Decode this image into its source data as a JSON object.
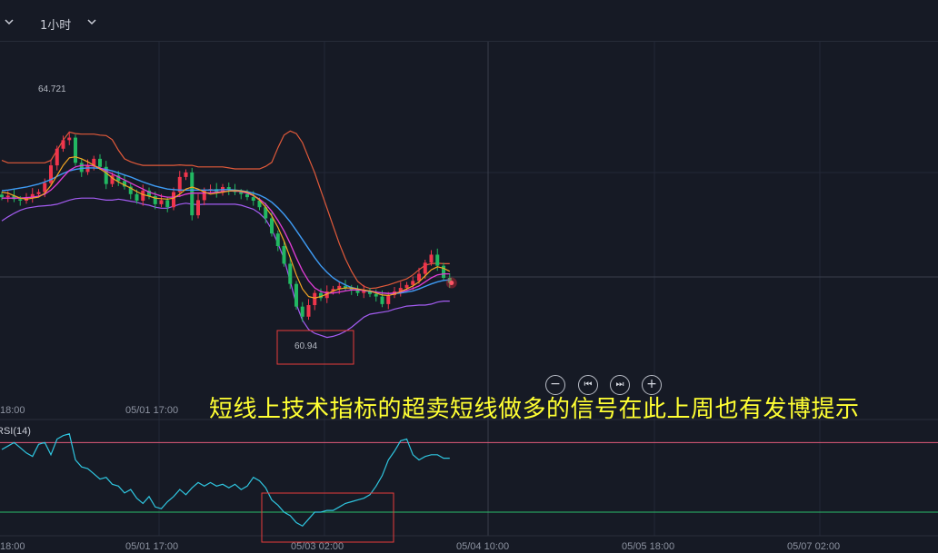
{
  "toolbar": {
    "interval": "1小时"
  },
  "zoom_controls": {
    "zoom_out": "−",
    "prev": "⏮",
    "next": "⏭",
    "zoom_in": "+"
  },
  "annotation": {
    "text": "短线上技术指标的超卖短线做多的信号在此上周也有发博提示"
  },
  "colors": {
    "background": "#161a25",
    "up_candle": "#f0354c",
    "down_candle": "#22b862",
    "boll_outer": "#e25a3a",
    "boll_lower": "#a45cf2",
    "ma_short": "#f5a623",
    "ma_mid": "#e23dd8",
    "ma_long": "#3e9bf4",
    "rsi_line": "#2fc6e0",
    "rsi_upper_level": "#e25a7a",
    "rsi_lower_level": "#2bbd6a",
    "highlight_box": "#e83c3c"
  },
  "chart_data": {
    "type": "candlestick",
    "main": {
      "high_label": "64.721",
      "low_label": "60.94",
      "x_ticks": [
        "18:00",
        "05/01 17:00"
      ],
      "price_range": [
        60.2,
        65.6
      ],
      "closes": [
        63.42,
        63.45,
        63.38,
        63.35,
        63.41,
        63.48,
        63.52,
        63.7,
        64.05,
        64.38,
        64.55,
        64.6,
        64.1,
        63.92,
        64.05,
        64.18,
        64.02,
        63.68,
        63.85,
        63.74,
        63.63,
        63.48,
        63.35,
        63.55,
        63.44,
        63.28,
        63.36,
        63.22,
        63.52,
        63.82,
        63.91,
        63.06,
        63.36,
        63.55,
        63.58,
        63.51,
        63.62,
        63.56,
        63.52,
        63.48,
        63.42,
        63.35,
        63.22,
        63.0,
        62.7,
        62.45,
        62.1,
        61.7,
        61.25,
        61.05,
        61.28,
        61.52,
        61.42,
        61.55,
        61.6,
        61.66,
        61.62,
        61.58,
        61.52,
        61.56,
        61.5,
        61.45,
        61.3,
        61.48,
        61.55,
        61.62,
        61.68,
        61.76,
        61.9,
        62.12,
        62.28,
        62.06,
        61.82,
        61.72
      ],
      "boll_upper": [
        64.15,
        64.1,
        64.1,
        64.1,
        64.1,
        64.1,
        64.1,
        64.1,
        64.15,
        64.35,
        64.55,
        64.71,
        64.68,
        64.67,
        64.67,
        64.67,
        64.65,
        64.64,
        64.56,
        64.35,
        64.18,
        64.12,
        64.08,
        64.05,
        64.05,
        64.05,
        64.05,
        64.05,
        64.05,
        64.06,
        64.05,
        64.05,
        64.02,
        64.02,
        64.02,
        64.02,
        64.02,
        64.0,
        63.98,
        63.98,
        63.98,
        63.98,
        63.98,
        64.03,
        64.11,
        64.4,
        64.65,
        64.73,
        64.68,
        64.5,
        64.2,
        63.9,
        63.55,
        63.2,
        62.85,
        62.5,
        62.2,
        61.95,
        61.75,
        61.65,
        61.61,
        61.62,
        61.65,
        61.68,
        61.72,
        61.76,
        61.8,
        61.88,
        61.98,
        62.07,
        62.1,
        62.11,
        62.1,
        62.1
      ],
      "boll_lower": [
        62.95,
        63.03,
        63.1,
        63.16,
        63.2,
        63.22,
        63.24,
        63.25,
        63.26,
        63.28,
        63.32,
        63.36,
        63.39,
        63.4,
        63.4,
        63.4,
        63.38,
        63.36,
        63.36,
        63.38,
        63.36,
        63.34,
        63.32,
        63.28,
        63.26,
        63.22,
        63.2,
        63.2,
        63.24,
        63.28,
        63.3,
        63.28,
        63.27,
        63.28,
        63.28,
        63.28,
        63.28,
        63.28,
        63.28,
        63.26,
        63.22,
        63.18,
        63.1,
        62.98,
        62.78,
        62.5,
        62.2,
        61.75,
        61.3,
        60.98,
        60.8,
        60.72,
        60.68,
        60.64,
        60.66,
        60.7,
        60.76,
        60.84,
        60.94,
        61.04,
        61.1,
        61.12,
        61.14,
        61.16,
        61.2,
        61.23,
        61.26,
        61.27,
        61.28,
        61.28,
        61.3,
        61.34,
        61.36,
        61.36
      ],
      "ma_short": [
        63.52,
        63.5,
        63.45,
        63.4,
        63.38,
        63.4,
        63.42,
        63.5,
        63.65,
        63.85,
        64.05,
        64.2,
        64.22,
        64.18,
        64.12,
        64.05,
        63.98,
        63.9,
        63.8,
        63.72,
        63.66,
        63.6,
        63.53,
        63.47,
        63.44,
        63.4,
        63.39,
        63.38,
        63.4,
        63.48,
        63.58,
        63.62,
        63.58,
        63.52,
        63.48,
        63.5,
        63.52,
        63.54,
        63.55,
        63.54,
        63.52,
        63.46,
        63.36,
        63.22,
        63.05,
        62.82,
        62.55,
        62.22,
        61.88,
        61.6,
        61.45,
        61.42,
        61.45,
        61.5,
        61.56,
        61.6,
        61.62,
        61.62,
        61.6,
        61.58,
        61.56,
        61.52,
        61.48,
        61.47,
        61.5,
        61.55,
        61.6,
        61.66,
        61.74,
        61.86,
        61.98,
        62.04,
        62.01,
        61.95
      ],
      "ma_mid": [
        63.4,
        63.4,
        63.4,
        63.4,
        63.41,
        63.42,
        63.44,
        63.48,
        63.56,
        63.68,
        63.82,
        63.95,
        64.02,
        64.05,
        64.05,
        64.04,
        64.0,
        63.94,
        63.88,
        63.82,
        63.76,
        63.7,
        63.64,
        63.58,
        63.52,
        63.48,
        63.44,
        63.42,
        63.42,
        63.44,
        63.48,
        63.5,
        63.5,
        63.5,
        63.51,
        63.52,
        63.53,
        63.54,
        63.54,
        63.53,
        63.5,
        63.45,
        63.38,
        63.28,
        63.14,
        62.96,
        62.75,
        62.5,
        62.22,
        61.96,
        61.76,
        61.62,
        61.55,
        61.52,
        61.52,
        61.54,
        61.56,
        61.58,
        61.58,
        61.57,
        61.56,
        61.54,
        61.52,
        61.51,
        61.52,
        61.54,
        61.57,
        61.61,
        61.66,
        61.74,
        61.82,
        61.88,
        61.9,
        61.9
      ],
      "ma_long": [
        63.55,
        63.56,
        63.58,
        63.6,
        63.62,
        63.65,
        63.68,
        63.72,
        63.77,
        63.83,
        63.89,
        63.94,
        63.97,
        63.99,
        64.0,
        64.0,
        63.99,
        63.97,
        63.94,
        63.9,
        63.86,
        63.82,
        63.77,
        63.72,
        63.68,
        63.64,
        63.61,
        63.58,
        63.57,
        63.56,
        63.56,
        63.56,
        63.56,
        63.56,
        63.56,
        63.56,
        63.57,
        63.57,
        63.56,
        63.55,
        63.53,
        63.5,
        63.46,
        63.4,
        63.32,
        63.21,
        63.08,
        62.93,
        62.76,
        62.58,
        62.4,
        62.22,
        62.06,
        61.93,
        61.82,
        61.74,
        61.68,
        61.63,
        61.6,
        61.57,
        61.55,
        61.53,
        61.52,
        61.51,
        61.51,
        61.52,
        61.54,
        61.56,
        61.6,
        61.65,
        61.7,
        61.74,
        61.77,
        61.78
      ]
    },
    "rsi": {
      "label": "RSI(14)",
      "x_ticks": [
        "18:00",
        "05/01 17:00",
        "05/03 02:00",
        "05/04 10:00",
        "05/05 18:00",
        "05/07 02:00"
      ],
      "upper_level": 70,
      "lower_level": 30,
      "range": [
        18,
        78
      ],
      "values": [
        66,
        68,
        70,
        67,
        64,
        62,
        69,
        70,
        63,
        72,
        74,
        75,
        60,
        56,
        55,
        52,
        49,
        50,
        46,
        45,
        41,
        43,
        38,
        35,
        39,
        33,
        32,
        36,
        39,
        43,
        40,
        44,
        47,
        45,
        47,
        45,
        46,
        44,
        46,
        43,
        45,
        50,
        48,
        44,
        37,
        34,
        30,
        28,
        24,
        22,
        26,
        30,
        30,
        31,
        31,
        33,
        35,
        36,
        37,
        38,
        40,
        45,
        51,
        60,
        65,
        71,
        72,
        63,
        60,
        62,
        63,
        63,
        61,
        61
      ]
    }
  }
}
